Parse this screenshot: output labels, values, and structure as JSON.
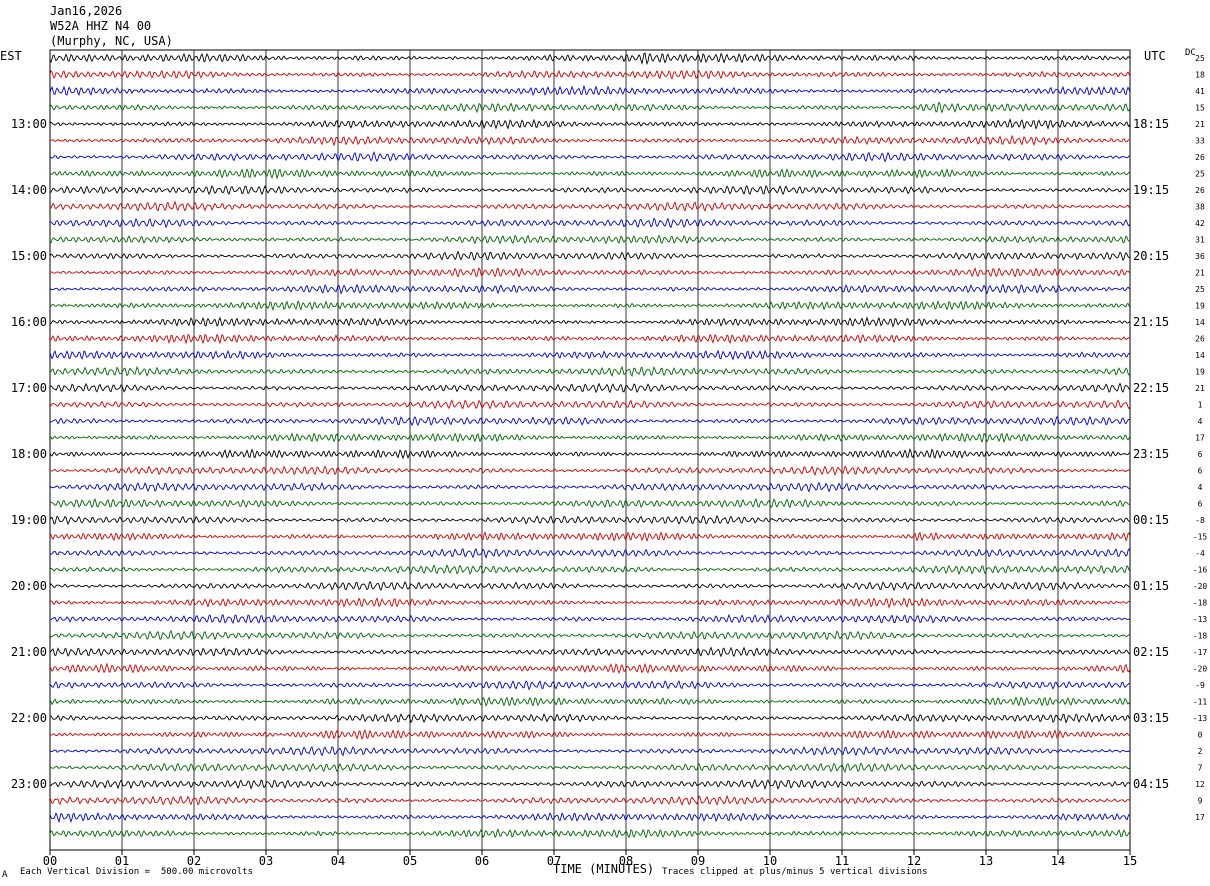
{
  "header": {
    "date": "Jan16,2026",
    "station": "W52A HHZ N4 00",
    "location": "(Murphy, NC, USA)"
  },
  "left_axis_title": "EST",
  "right_axis_title": "UTC",
  "offset_title": "DC",
  "footer": {
    "scale_note": "Each Vertical Division =  500.00 microvolts",
    "clip_note": "Traces clipped at plus/minus 5 vertical divisions",
    "corner_mark": "A"
  },
  "colors": {
    "trace_cycle": [
      "#000000",
      "#d00000",
      "#0000cc",
      "#006600"
    ],
    "grid": "#000000",
    "background": "#ffffff"
  },
  "chart_data": {
    "type": "seismogram",
    "xlabel": "TIME (MINUTES)",
    "xlim": [
      0,
      15
    ],
    "x_ticks": [
      "00",
      "01",
      "02",
      "03",
      "04",
      "05",
      "06",
      "07",
      "08",
      "09",
      "10",
      "11",
      "12",
      "13",
      "14",
      "15"
    ],
    "trace_minutes": 15,
    "vertical_division_microvolts": 500.0,
    "clip_divisions": 5,
    "left_time_labels": [
      "13:00",
      "14:00",
      "15:00",
      "16:00",
      "17:00",
      "18:00",
      "19:00",
      "20:00",
      "21:00",
      "22:00",
      "23:00"
    ],
    "right_time_labels": [
      "18:15",
      "19:15",
      "20:15",
      "21:15",
      "22:15",
      "23:15",
      "00:15",
      "01:15",
      "02:15",
      "03:15",
      "04:15"
    ],
    "first_hour_label_trace": 4,
    "traces_per_hour": 4,
    "trace_count": 48,
    "dc_offsets": [
      25,
      18,
      41,
      15,
      21,
      33,
      26,
      25,
      26,
      38,
      42,
      31,
      36,
      21,
      25,
      19,
      14,
      26,
      14,
      19,
      21,
      1,
      4,
      17,
      6,
      6,
      4,
      6,
      -8,
      -15,
      -4,
      -16,
      -20,
      -18,
      -13,
      -18,
      -17,
      -20,
      -9,
      -11,
      -13,
      0,
      2,
      7,
      12,
      9,
      17
    ],
    "events": [
      {
        "trace": 0,
        "minute": 8.3,
        "label": ""
      },
      {
        "trace": 3,
        "minute": 12.3,
        "label": ""
      },
      {
        "trace": 29,
        "minute": 12.1,
        "label": ""
      }
    ]
  }
}
